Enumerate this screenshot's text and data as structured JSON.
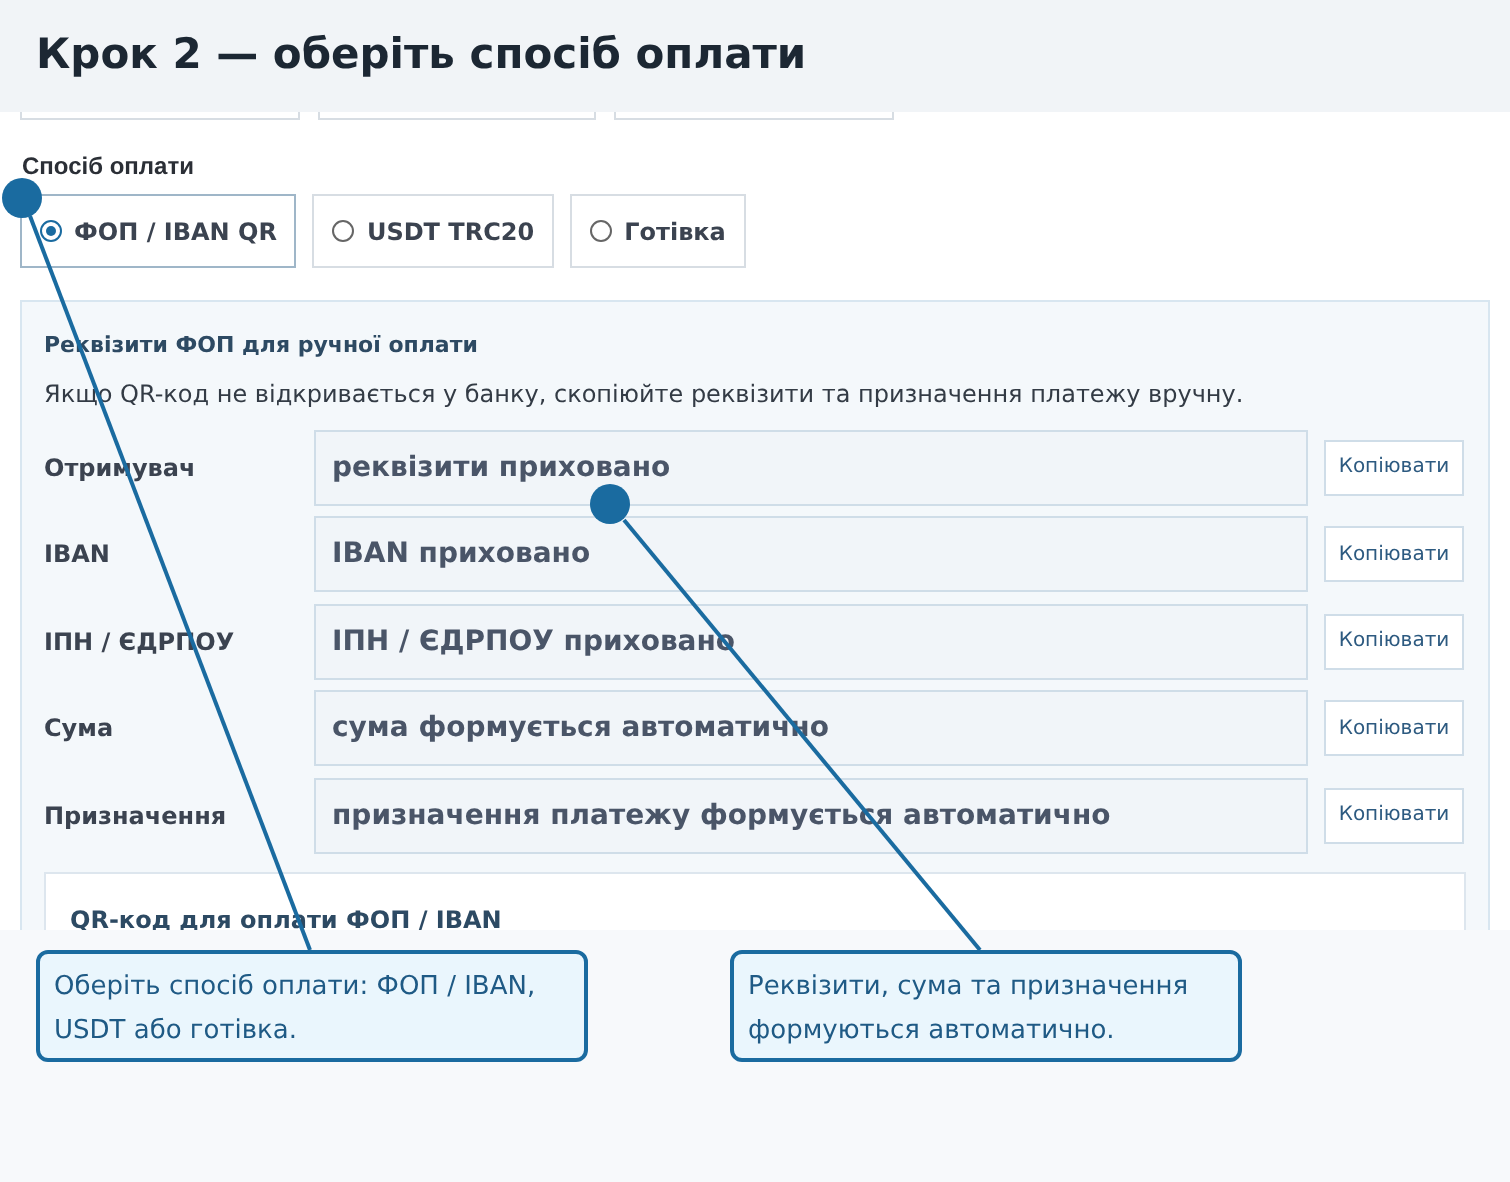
{
  "header": {
    "title": "Крок 2 — оберіть спосіб оплати"
  },
  "payment_method": {
    "label": "Спосіб оплати",
    "options": [
      {
        "label": "ФОП / IBAN QR",
        "selected": true
      },
      {
        "label": "USDT TRC20",
        "selected": false
      },
      {
        "label": "Готівка",
        "selected": false
      }
    ]
  },
  "details": {
    "title": "Реквізити ФОП для ручної оплати",
    "hint": "Якщо QR-код не відкривається у банку, скопіюйте реквізити та призначення платежу вручну.",
    "rows": [
      {
        "label": "Отримувач",
        "value": "реквізити приховано",
        "button": "Копіювати"
      },
      {
        "label": "IBAN",
        "value": "IBAN приховано",
        "button": "Копіювати"
      },
      {
        "label": "ІПН / ЄДРПОУ",
        "value": "ІПН / ЄДРПОУ приховано",
        "button": "Копіювати"
      },
      {
        "label": "Сума",
        "value": "сума формується автоматично",
        "button": "Копіювати"
      },
      {
        "label": "Призначення",
        "value": "призначення платежу формується автоматично",
        "button": "Копіювати"
      }
    ],
    "qr_title": "QR-код для оплати ФОП / IBAN"
  },
  "callouts": [
    {
      "text": "Оберіть спосіб оплати: ФОП / IBAN, USDT або готівка."
    },
    {
      "text": "Реквізити, сума та призначення формуються автоматично."
    }
  ]
}
